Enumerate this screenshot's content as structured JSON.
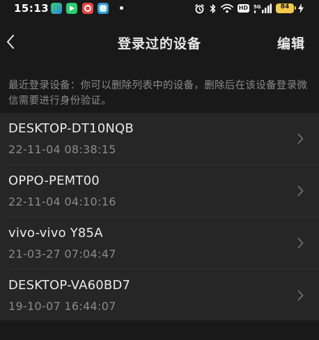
{
  "status_bar": {
    "time": "15:13",
    "network_badge": "HD",
    "signal_label": "5G",
    "battery_level": "84",
    "icons": [
      "app-icon",
      "video-icon",
      "compass-icon",
      "browser-icon",
      "alarm-icon",
      "bluetooth-icon",
      "wifi-icon",
      "signal-icon",
      "battery-icon",
      "charging-icon"
    ]
  },
  "nav": {
    "title": "登录过的设备",
    "edit_label": "编辑",
    "back_icon": "chevron-left-icon"
  },
  "description": "最近登录设备：你可以删除列表中的设备，删除后在该设备登录微信需要进行身份验证。",
  "devices": [
    {
      "name": "DESKTOP-DT10NQB",
      "time": "22-11-04 08:38:15"
    },
    {
      "name": "OPPO-PEMT00",
      "time": "22-11-04 04:10:16"
    },
    {
      "name": "vivo-vivo Y85A",
      "time": "21-03-27 07:04:47"
    },
    {
      "name": "DESKTOP-VA60BD7",
      "time": "19-10-07 16:44:07"
    }
  ],
  "colors": {
    "background": "#191919",
    "list_background": "#262626",
    "primary_text": "#eaeaea",
    "secondary_text": "#8b8b8b",
    "battery": "#f2c94c"
  }
}
